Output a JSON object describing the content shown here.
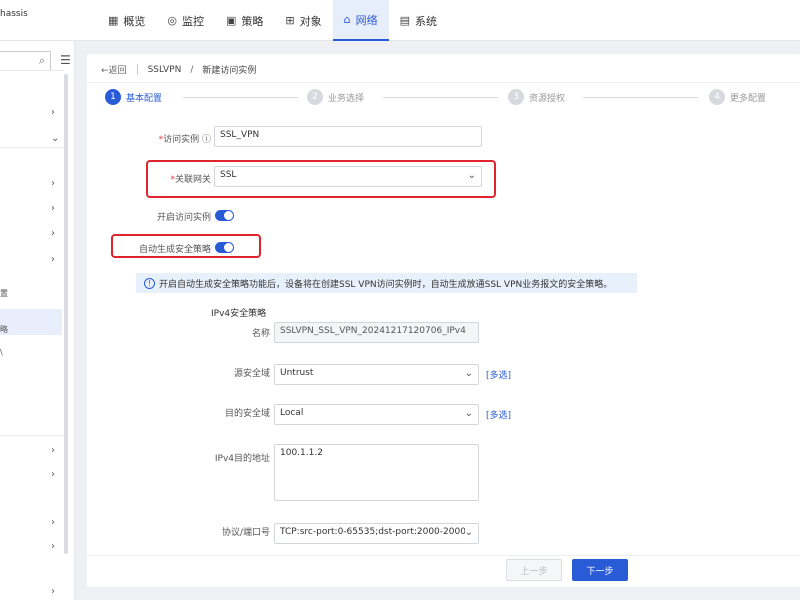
{
  "app": {
    "brand_fragment": "hassis"
  },
  "nav": {
    "items": [
      {
        "label": "概览",
        "icon": "dashboard-icon"
      },
      {
        "label": "监控",
        "icon": "monitor-icon"
      },
      {
        "label": "策略",
        "icon": "policy-icon"
      },
      {
        "label": "对象",
        "icon": "object-icon"
      },
      {
        "label": "网络",
        "icon": "network-icon",
        "active": true
      },
      {
        "label": "系统",
        "icon": "system-icon"
      }
    ]
  },
  "sidebar": {
    "search_placeholder": "",
    "text_fragment_1": "置",
    "text_fragment_2": "略",
    "text_fragment_3": "\\"
  },
  "breadcrumb": {
    "back": "返回",
    "parent": "SSLVPN",
    "separator": "/",
    "current": "新建访问实例"
  },
  "steps": [
    {
      "num": "1",
      "label": "基本配置",
      "active": true
    },
    {
      "num": "2",
      "label": "业务选择"
    },
    {
      "num": "3",
      "label": "资源授权"
    },
    {
      "num": "4",
      "label": "更多配置"
    }
  ],
  "form": {
    "instance_label": "访问实例",
    "instance_value": "SSL_VPN",
    "gateway_label": "关联网关",
    "gateway_value": "SSL",
    "enable_label": "开启访问实例",
    "auto_policy_label": "自动生成安全策略",
    "info_text": "开启自动生成安全策略功能后，设备将在创建SSL VPN访问实例时，自动生成放通SSL VPN业务报文的安全策略。",
    "ipv4_section": "IPv4安全策略",
    "name_label": "名称",
    "name_value": "SSLVPN_SSL_VPN_20241217120706_IPv4",
    "src_zone_label": "源安全域",
    "src_zone_value": "Untrust",
    "dst_zone_label": "目的安全域",
    "dst_zone_value": "Local",
    "multi_select": "[多选]",
    "dst_addr_label": "IPv4目的地址",
    "dst_addr_value": "100.1.1.2",
    "proto_label": "协议/端口号",
    "proto_value": "TCP:src-port:0-65535;dst-port:2000-2000"
  },
  "buttons": {
    "prev": "上一步",
    "next": "下一步"
  },
  "colors": {
    "accent": "#2a5bd7",
    "highlight": "#e0242e"
  }
}
